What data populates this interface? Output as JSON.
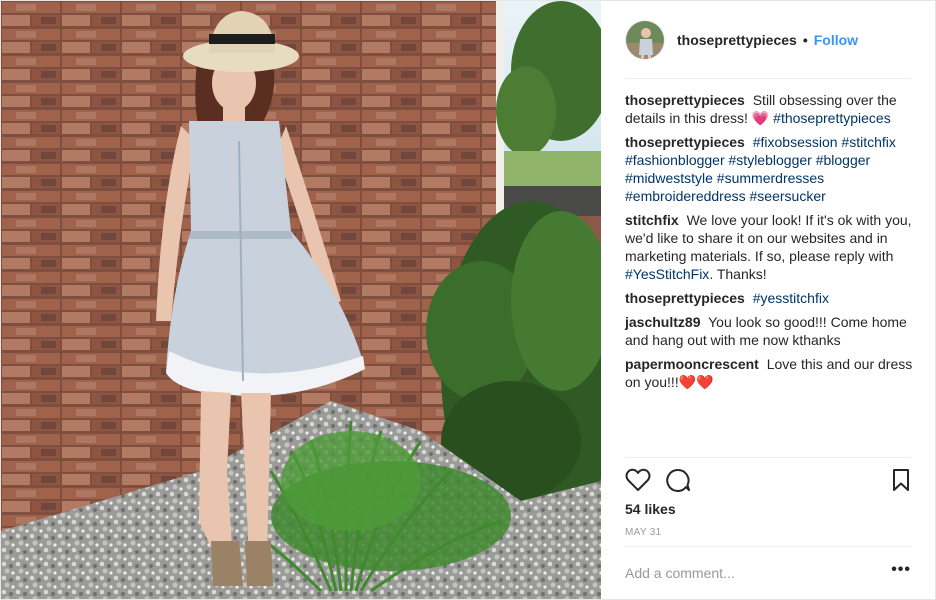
{
  "header": {
    "username": "thoseprettypieces",
    "separator": "•",
    "follow_label": "Follow"
  },
  "comments": [
    {
      "user": "thoseprettypieces",
      "text": "Still obsessing over the details in this dress!",
      "emoji": "💗",
      "tags": "#thoseprettypieces"
    },
    {
      "user": "thoseprettypieces",
      "tags": "#fixobsession #stitchfix #fashionblogger #styleblogger #blogger #midweststyle #summerdresses #embroidereddress #seersucker"
    },
    {
      "user": "stitchfix",
      "text_before": "We love your look! If it's ok with you, we'd like to share it on our websites and in marketing materials. If so, please reply with",
      "tag": "#YesStitchFix",
      "text_after": ". Thanks!"
    },
    {
      "user": "thoseprettypieces",
      "tags": "#yesstitchfix"
    },
    {
      "user": "jaschultz89",
      "text": "You look so good!!! Come home and hang out with me now kthanks"
    },
    {
      "user": "papermooncrescent",
      "text": "Love this and our dress on you!!!",
      "emoji": "❤️❤️"
    }
  ],
  "actions": {
    "like_icon": "heart-outline-icon",
    "comment_icon": "speech-bubble-icon",
    "save_icon": "bookmark-icon"
  },
  "likes_label": "54 likes",
  "date_label": "MAY 31",
  "add_comment": {
    "placeholder": "Add a comment...",
    "more_label": "•••"
  },
  "colors": {
    "link": "#003569",
    "follow": "#3897f0",
    "border": "#efefef"
  }
}
